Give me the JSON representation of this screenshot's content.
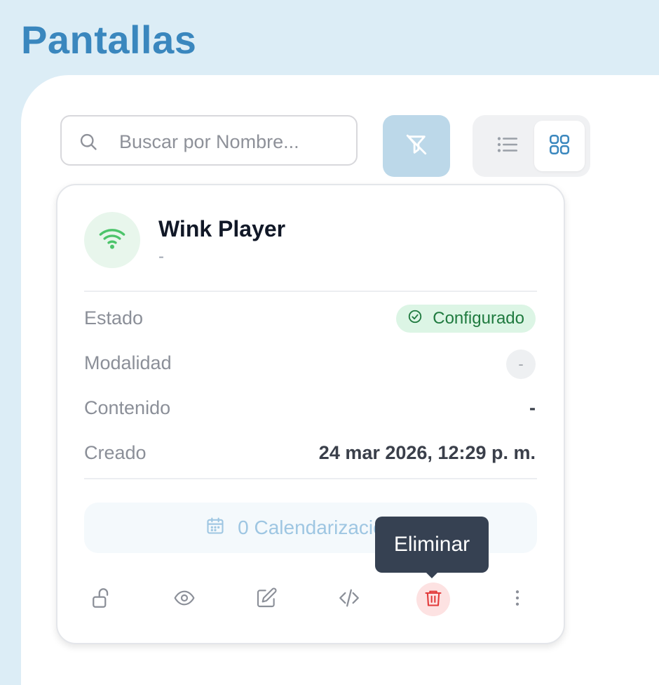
{
  "page": {
    "title": "Pantallas"
  },
  "search": {
    "placeholder": "Buscar por Nombre..."
  },
  "toolbar": {
    "filter_icon": "filter-off-icon",
    "view_modes": [
      "list",
      "grid"
    ],
    "active_view": "grid"
  },
  "card": {
    "name": "Wink Player",
    "subtitle": "-",
    "status_icon": "wifi-icon",
    "rows": {
      "estado_label": "Estado",
      "estado_value": "Configurado",
      "modalidad_label": "Modalidad",
      "modalidad_value": "-",
      "contenido_label": "Contenido",
      "contenido_value": "-",
      "creado_label": "Creado",
      "creado_value": "24 mar 2026, 12:29 p. m."
    },
    "schedule": "0 Calendarizaciones",
    "actions": [
      "unlock-icon",
      "eye-icon",
      "edit-icon",
      "code-icon",
      "trash-icon",
      "more-vertical-icon"
    ]
  },
  "tooltip": {
    "text": "Eliminar"
  },
  "colors": {
    "brand": "#3a87be",
    "background": "#dcedf6",
    "success": "#1f7a3f",
    "danger": "#e23b3b"
  }
}
